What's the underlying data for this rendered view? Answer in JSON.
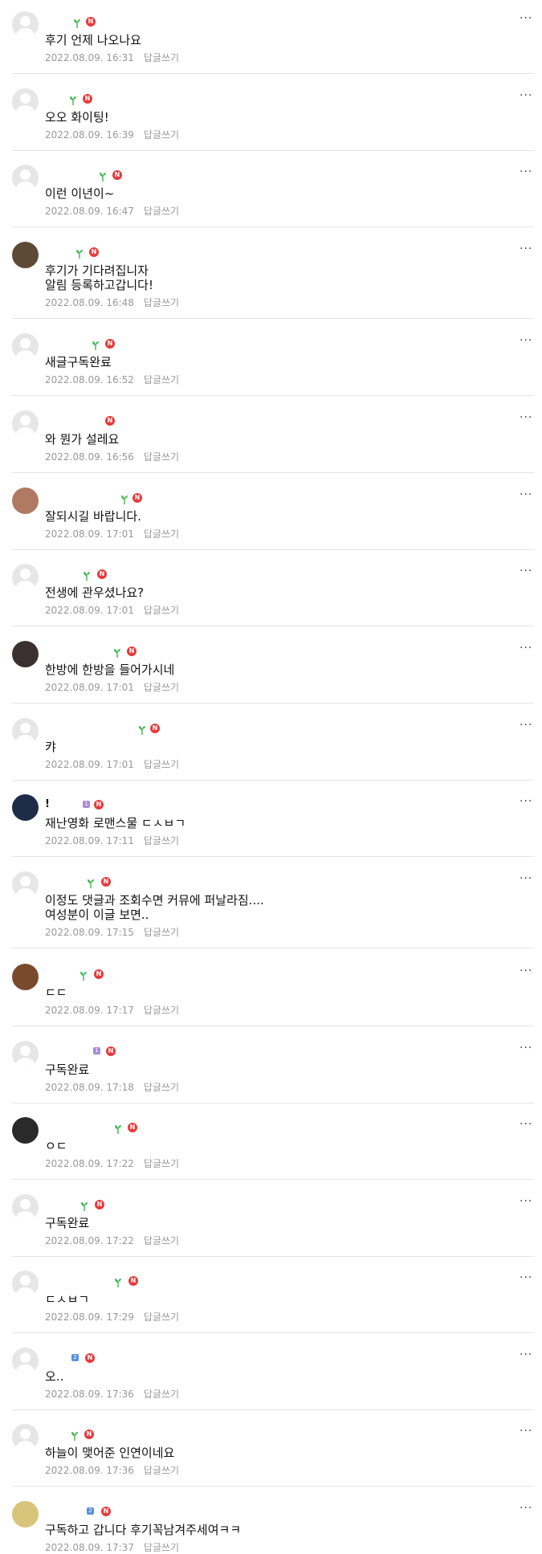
{
  "reply_label": "답글쓰기",
  "more_icon": "more-dots-icon",
  "colors": {
    "new_badge": "#e8393b",
    "sprout": "#3bb54a",
    "meta_text": "#999999",
    "divider": "#e5e5e5",
    "level_purple": "#a98bd8",
    "level_blue": "#5b8fe0"
  },
  "new_badge_text": "N",
  "comments": [
    {
      "text": "후기 언제 나오나요",
      "date": "2022.08.09. 16:31"
    },
    {
      "text": "오오 화이팅!",
      "date": "2022.08.09. 16:39"
    },
    {
      "text": "이런 이년이~",
      "date": "2022.08.09. 16:47"
    },
    {
      "text": "후기가 기다려집니자\n알림 등록하고갑니다!",
      "date": "2022.08.09. 16:48"
    },
    {
      "text": "새글구독완료",
      "date": "2022.08.09. 16:52"
    },
    {
      "text": "와 뭔가 설레요",
      "date": "2022.08.09. 16:56"
    },
    {
      "text": "잘되시길 바랍니다.",
      "date": "2022.08.09. 17:01"
    },
    {
      "text": "전생에 관우셨나요?",
      "date": "2022.08.09. 17:01"
    },
    {
      "text": "한방에 한방을 들어가시네",
      "date": "2022.08.09. 17:01"
    },
    {
      "text": "캬",
      "date": "2022.08.09. 17:01"
    },
    {
      "text": "재난영화 로맨스물 ㄷㅅㅂㄱ",
      "date": "2022.08.09. 17:11",
      "nick": "!",
      "level": "1"
    },
    {
      "text": "이정도 댓글과 조회수면 커뮤에 퍼날라짐....\n여성분이 이글 보면..",
      "date": "2022.08.09. 17:15"
    },
    {
      "text": "ㄷㄷ",
      "date": "2022.08.09. 17:17"
    },
    {
      "text": "구독완료",
      "date": "2022.08.09. 17:18",
      "level": "1"
    },
    {
      "text": "ㅇㄷ",
      "date": "2022.08.09. 17:22"
    },
    {
      "text": "구독완료",
      "date": "2022.08.09. 17:22"
    },
    {
      "text": "ㄷㅅㅂㄱ",
      "date": "2022.08.09. 17:29"
    },
    {
      "text": "오..",
      "date": "2022.08.09. 17:36",
      "level": "2"
    },
    {
      "text": "하늘이 맺어준 인연이네요",
      "date": "2022.08.09. 17:36"
    },
    {
      "text": "구독하고 갑니다 후기꼭남겨주세여ㅋㅋ",
      "date": "2022.08.09. 17:37",
      "level": "2"
    }
  ]
}
